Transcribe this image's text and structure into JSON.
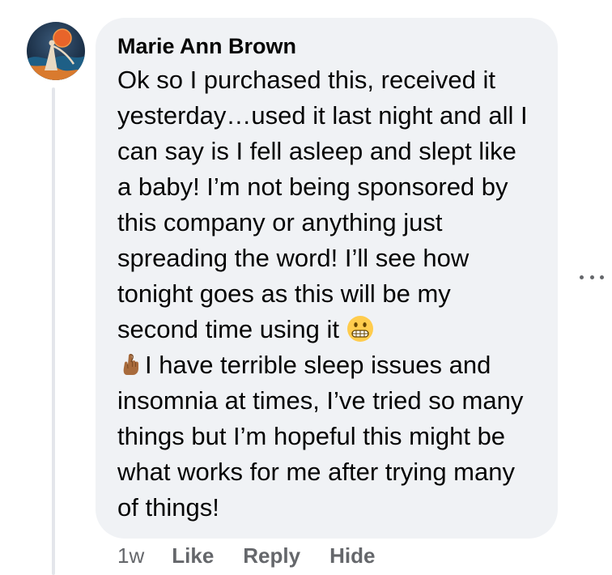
{
  "comment": {
    "author": "Marie Ann Brown",
    "text_before_emoji": "Ok so I purchased this, received it yesterday…used it last night and all I can say is I fell asleep and slept like a baby! I’m not being sponsored by this company or anything just spreading the word! I’ll see how tonight goes as this will be my second time using it ",
    "emoji_1": "grimacing-face",
    "text_between_emoji": " ",
    "emoji_2": "crossed-fingers",
    "text_after_emoji": "I have terrible sleep issues and insomnia at times, I’ve tried so many things but I’m hopeful this might be what works for me after trying many of things!",
    "time": "1w",
    "actions": {
      "like": "Like",
      "reply": "Reply",
      "hide": "Hide"
    }
  },
  "icons": {
    "more": "more-options-icon",
    "avatar": "avatar"
  },
  "colors": {
    "bubble_bg": "#f0f2f5",
    "text": "#050505",
    "secondary_text": "#65676b",
    "thread_line": "#e4e6eb"
  }
}
